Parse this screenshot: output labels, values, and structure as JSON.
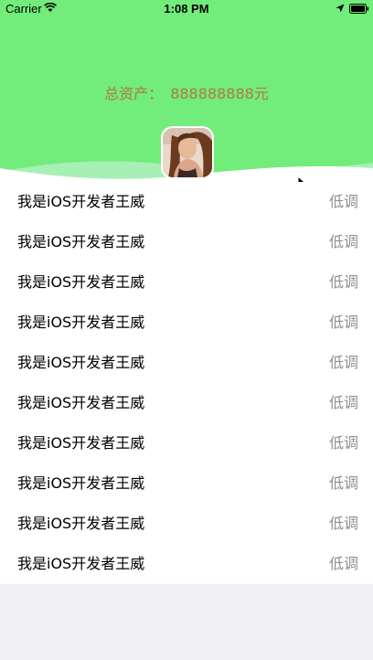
{
  "status_bar": {
    "carrier": "Carrier",
    "time": "1:08 PM"
  },
  "header": {
    "assets_label": "总资产：",
    "assets_value": "888888888元",
    "background_color": "#72ec7a"
  },
  "list": {
    "rows": [
      {
        "title": "我是iOS开发者王威",
        "detail": "低调"
      },
      {
        "title": "我是iOS开发者王威",
        "detail": "低调"
      },
      {
        "title": "我是iOS开发者王威",
        "detail": "低调"
      },
      {
        "title": "我是iOS开发者王威",
        "detail": "低调"
      },
      {
        "title": "我是iOS开发者王威",
        "detail": "低调"
      },
      {
        "title": "我是iOS开发者王威",
        "detail": "低调"
      },
      {
        "title": "我是iOS开发者王威",
        "detail": "低调"
      },
      {
        "title": "我是iOS开发者王威",
        "detail": "低调"
      },
      {
        "title": "我是iOS开发者王威",
        "detail": "低调"
      },
      {
        "title": "我是iOS开发者王威",
        "detail": "低调"
      }
    ]
  }
}
